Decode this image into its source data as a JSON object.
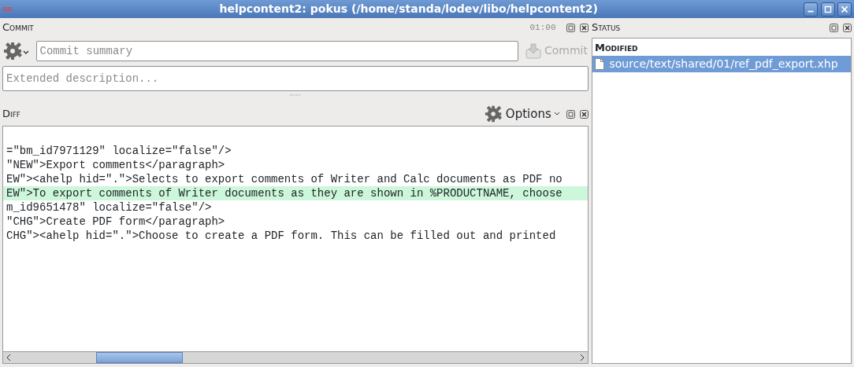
{
  "window": {
    "title": "helpcontent2: pokus (/home/standa/lodev/libo/helpcontent2)"
  },
  "commit": {
    "title": "Commit",
    "timer": "01:00",
    "summary_placeholder": "Commit summary",
    "description_placeholder": "Extended description...",
    "commit_button": "Commit"
  },
  "diff": {
    "title": "Diff",
    "options_button": "Options",
    "lines": [
      {
        "text": "=\"bm_id7971129\" localize=\"false\"/>",
        "highlighted": false
      },
      {
        "text": "\"NEW\">Export comments</paragraph>",
        "highlighted": false
      },
      {
        "text": "EW\"><ahelp hid=\".\">Selects to export comments of Writer and Calc documents as PDF no",
        "highlighted": false
      },
      {
        "text": "EW\">To export comments of Writer documents as they are shown in %PRODUCTNAME, choose",
        "highlighted": true
      },
      {
        "text": "m_id9651478\" localize=\"false\"/>",
        "highlighted": false
      },
      {
        "text": "\"CHG\">Create PDF form</paragraph>",
        "highlighted": false
      },
      {
        "text": "CHG\"><ahelp hid=\".\">Choose to create a PDF form. This can be filled out and printed",
        "highlighted": false
      }
    ]
  },
  "status": {
    "title": "Status",
    "groups": [
      {
        "title": "Modified",
        "files": [
          {
            "name": "source/text/shared/01/ref_pdf_export.xhp",
            "selected": true
          }
        ]
      }
    ]
  }
}
